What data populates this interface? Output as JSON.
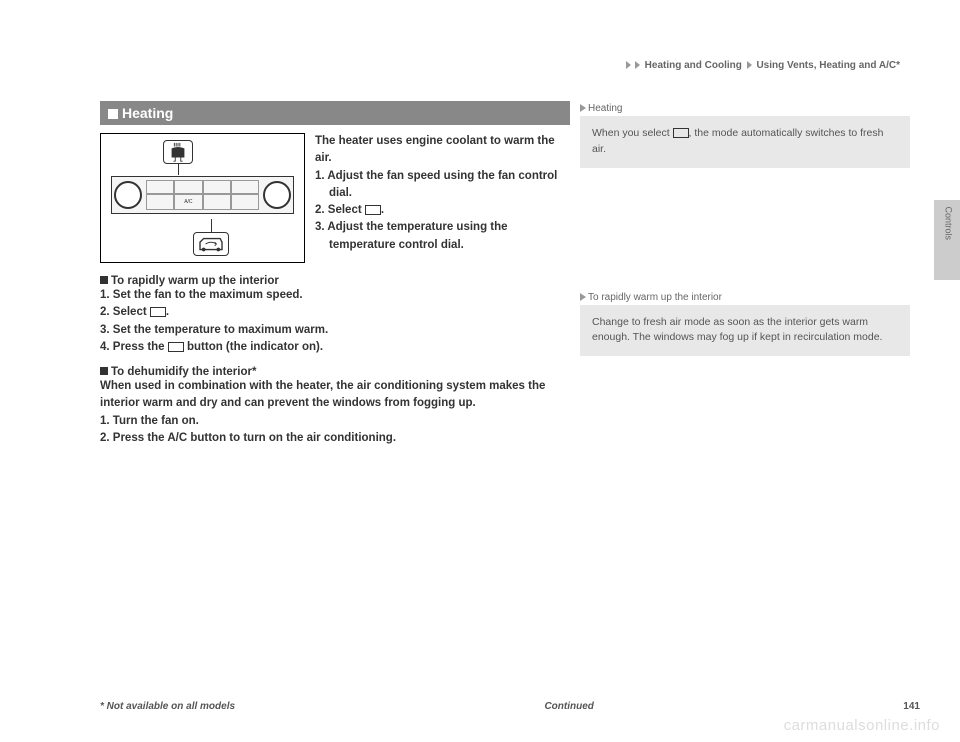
{
  "breadcrumb": {
    "part1": "Heating and Cooling",
    "part2": "Using Vents, Heating and A/C*"
  },
  "section": {
    "title": "Heating"
  },
  "intro": {
    "line1": "The heater uses engine coolant to warm the air.",
    "step1": "1. Adjust the fan speed using the fan control",
    "step1b": "dial.",
    "step2": "2. Select",
    "step2b": ".",
    "step3": "3. Adjust the temperature using the",
    "step3b": "temperature control dial."
  },
  "rapid": {
    "heading": "To rapidly warm up the interior",
    "s1": "1. Set the fan to the maximum speed.",
    "s2": "2. Select",
    "s2b": ".",
    "s3": "3. Set the temperature to maximum warm.",
    "s4": "4. Press the",
    "s4b": "button (the indicator on)."
  },
  "dehumidify": {
    "heading": "To dehumidify the interior*",
    "p1": "When used in combination with the heater, the air conditioning system makes the interior warm and dry and can prevent the windows from fogging up.",
    "s1": "1. Turn the fan on.",
    "s2": "2. Press the A/C button to turn on the air conditioning."
  },
  "notes": {
    "label1": "Heating",
    "text1a": "When you select",
    "text1b": ", the mode automatically switches to fresh air.",
    "label2": "To rapidly warm up the interior",
    "text2": "Change to fresh air mode as soon as the interior gets warm enough. The windows may fog up if kept in recirculation mode."
  },
  "sidebar": "Controls",
  "footer": {
    "left": "* Not available on all models",
    "center": "Continued",
    "pageno": "141"
  },
  "watermark": "carmanualsonline.info"
}
